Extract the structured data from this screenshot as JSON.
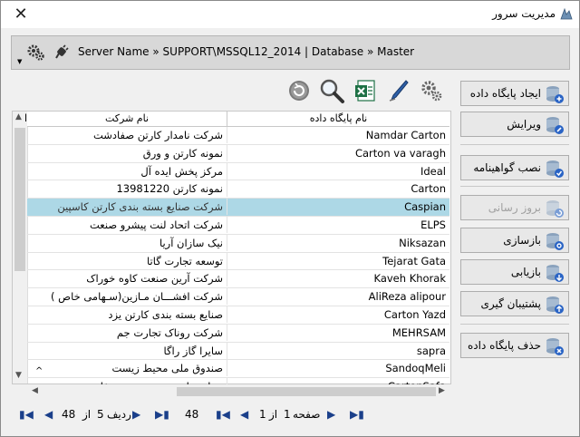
{
  "window": {
    "title": "مدیریت سرور",
    "close_glyph": "✕"
  },
  "server_bar": {
    "text": "Server Name » SUPPORT\\MSSQL12_2014 | Database » Master",
    "dropdown_glyph": "▼"
  },
  "grid": {
    "headers": {
      "database_name": "نام پایگاه داده",
      "company_name": "نام شرکت",
      "extra": "ا"
    },
    "rows": [
      {
        "db": "Namdar Carton",
        "company": "شرکت نامدار کارتن صفادشت"
      },
      {
        "db": "Carton va varagh",
        "company": "نمونه کارتن و ورق"
      },
      {
        "db": "Ideal",
        "company": "مرکز پخش ایده آل"
      },
      {
        "db": "Carton",
        "company": "نمونه کارتن 13981220"
      },
      {
        "db": "Caspian",
        "company": "شرکت صنایع بسته بندی کارتن کاسپین",
        "selected": true
      },
      {
        "db": "ELPS",
        "company": "شرکت اتحاد لنت پیشرو صنعت"
      },
      {
        "db": "Niksazan",
        "company": "نیک سازان آریا"
      },
      {
        "db": "Tejarat Gata",
        "company": "توسعه تجارت گاتا"
      },
      {
        "db": "Kaveh Khorak",
        "company": "شرکت آرین صنعت کاوه خوراک"
      },
      {
        "db": "AliReza alipour",
        "company": "شرکت افشـــان مـازین(سـهامی خاص )"
      },
      {
        "db": "Carton Yazd",
        "company": "صنایع بسته بندی کارتن یزد"
      },
      {
        "db": "MEHRSAM",
        "company": "شرکت روناک تجارت جم"
      },
      {
        "db": "sapra",
        "company": "سایرا گاز راگا"
      },
      {
        "db": "SandoqMeli",
        "company": "صندوق ملی محیط زیست"
      },
      {
        "db": "CartonSafa",
        "company": "صنایع چاپ و بسته بندی صفا"
      }
    ]
  },
  "pager_rows": {
    "label": "ردیف",
    "current": "5",
    "of": "از",
    "total": "48"
  },
  "pager_pages": {
    "label": "صفحه",
    "current": "1",
    "of": "از",
    "total": "1",
    "count": "48"
  },
  "sidebar": {
    "create_db": "ایجاد پایگاه داده",
    "edit": "ویرایش",
    "install_cert": "نصب گواهینامه",
    "update": "بروز رسانی",
    "restore": "بازسازی",
    "retrieve": "بازیابی",
    "backup": "پشتیبان گیری",
    "delete_db": "حذف پایگاه داده"
  },
  "colors": {
    "accent_blue": "#2a64c5",
    "selected_row": "#add8e6",
    "pager_blue": "#1a3f8a"
  }
}
